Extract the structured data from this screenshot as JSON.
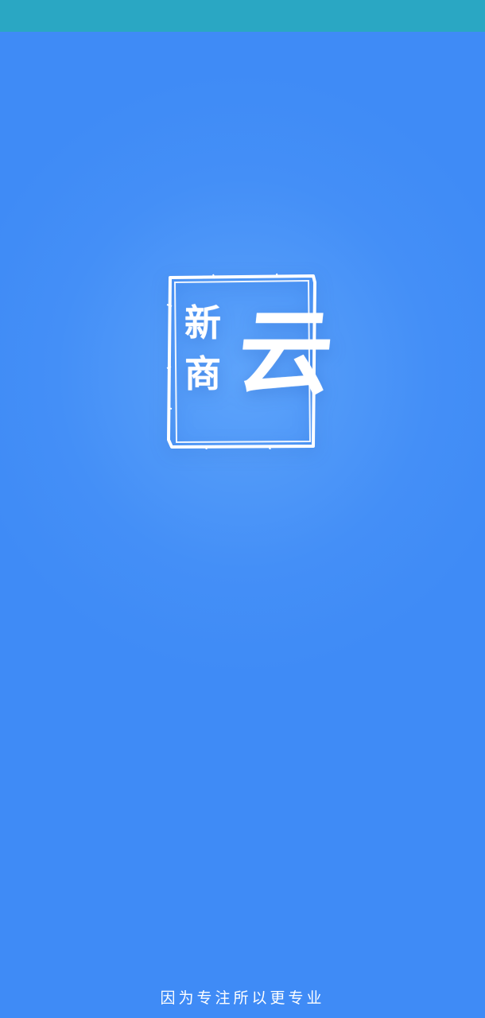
{
  "status_bar": {
    "color": "#2aa7c3"
  },
  "splash": {
    "background_color": "#3f8bf6",
    "logo": {
      "icon": "seal-logo-icon",
      "characters": [
        "新",
        "商",
        "云"
      ]
    },
    "slogan": "因为专注所以更专业"
  }
}
